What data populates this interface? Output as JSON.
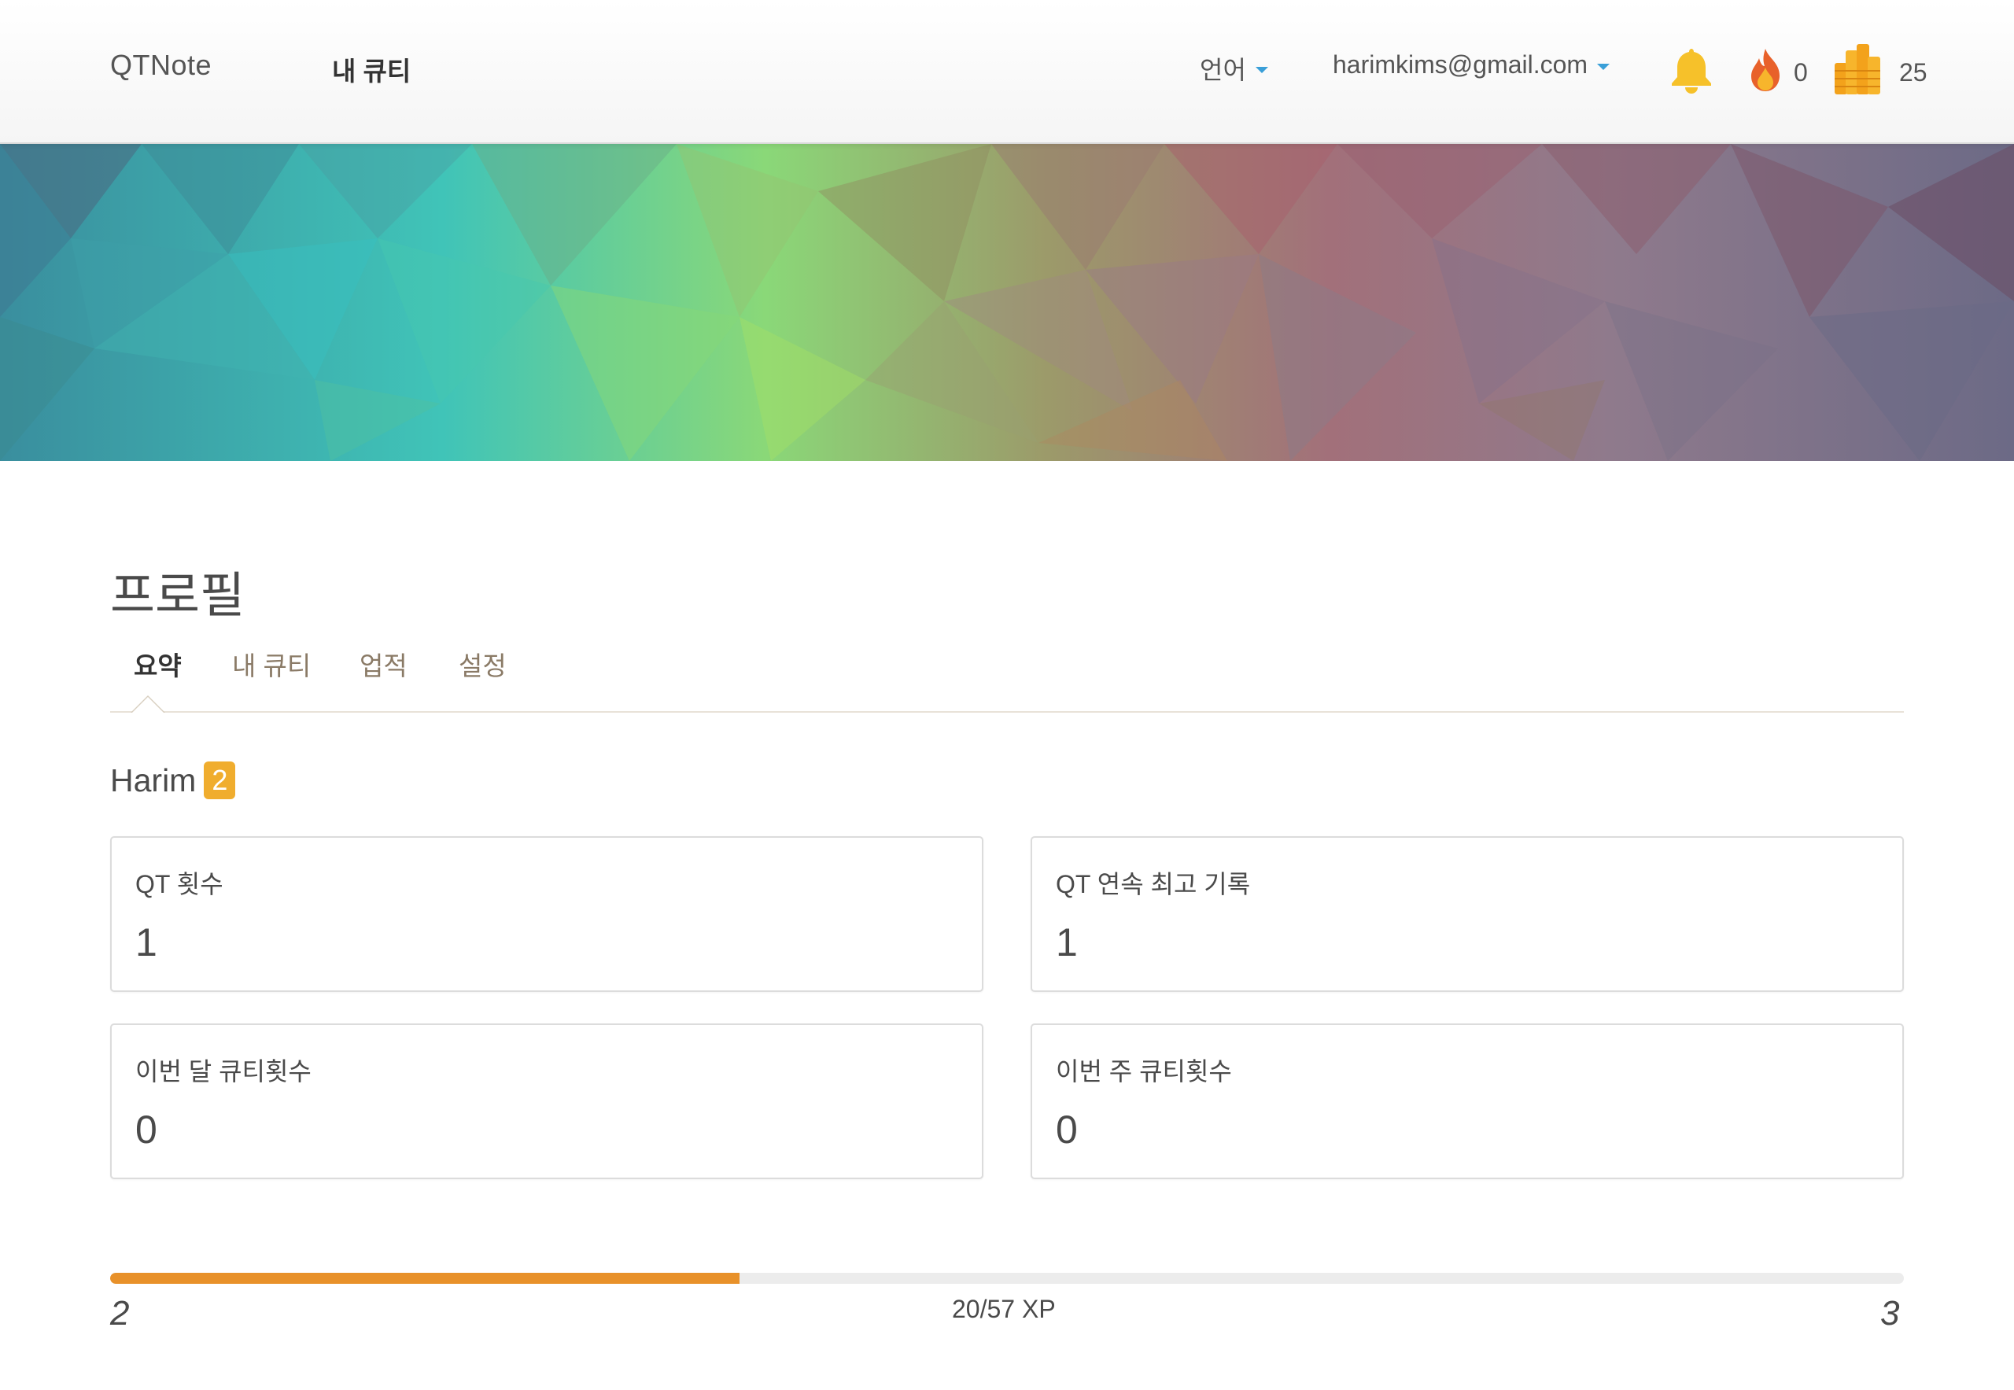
{
  "navbar": {
    "brand": "QTNote",
    "active_link": "내 큐티",
    "language_label": "언어",
    "user_email": "harimkims@gmail.com",
    "icons": [
      "bell-icon",
      "fire-icon",
      "coins-icon"
    ],
    "streak_count": "0",
    "coin_count": "25"
  },
  "banner": {
    "style": "low-poly gradient"
  },
  "profile": {
    "title": "프로필",
    "tabs": [
      {
        "label": "요약",
        "active": true
      },
      {
        "label": "내 큐티",
        "active": false
      },
      {
        "label": "업적",
        "active": false
      },
      {
        "label": "설정",
        "active": false
      }
    ],
    "username": "Harim",
    "level": "2"
  },
  "stats": [
    {
      "label": "QT 횟수",
      "value": "1"
    },
    {
      "label": "QT 연속 최고 기록",
      "value": "1"
    },
    {
      "label": "이번 달 큐티횟수",
      "value": "0"
    },
    {
      "label": "이번 주 큐티횟수",
      "value": "0"
    }
  ],
  "xp": {
    "current_level": "2",
    "next_level": "3",
    "text": "20/57 XP",
    "current": 20,
    "needed": 57
  },
  "colors": {
    "accent_orange": "#e8912a",
    "badge_orange": "#f0ad2e",
    "caret_blue": "#3a9fd8",
    "bell_yellow": "#f6c12a"
  }
}
